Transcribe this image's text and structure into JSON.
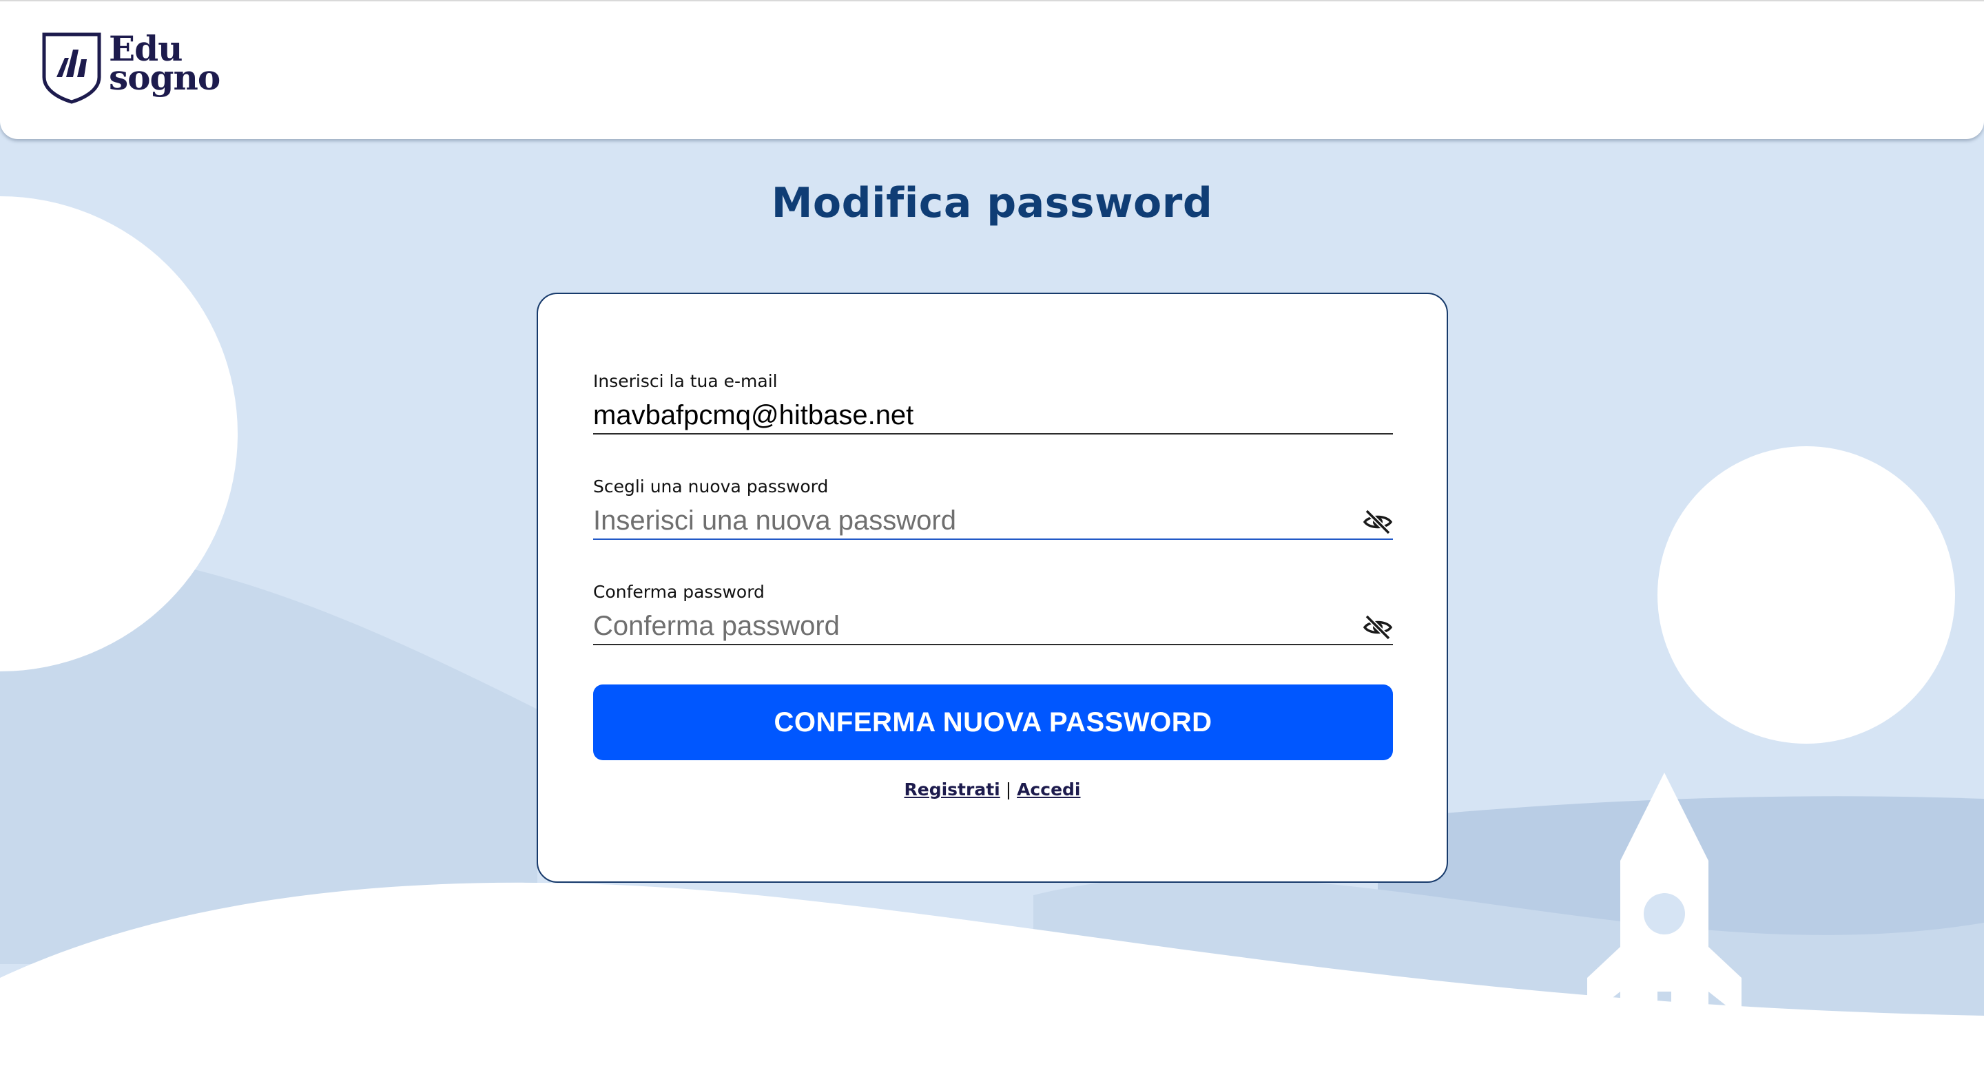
{
  "brand": {
    "logo_line1": "Edu",
    "logo_line2": "sogno",
    "logo_color": "#1d1b4d"
  },
  "page": {
    "title": "Modifica password"
  },
  "form": {
    "email_label": "Inserisci la tua e-mail",
    "email_value": "mavbafpcmq@hitbase.net",
    "new_password_label": "Scegli una nuova password",
    "new_password_placeholder": "Inserisci una nuova password",
    "confirm_password_label": "Conferma password",
    "confirm_password_placeholder": "Conferma password",
    "password_toggle_icon": "eye-off-icon",
    "submit_label": "CONFERMA NUOVA PASSWORD"
  },
  "links": {
    "register": "Registrati",
    "separator": "|",
    "login": "Accedi"
  },
  "colors": {
    "accent": "#0057ff",
    "title": "#0f3d75",
    "background": "#d6e4f4"
  }
}
